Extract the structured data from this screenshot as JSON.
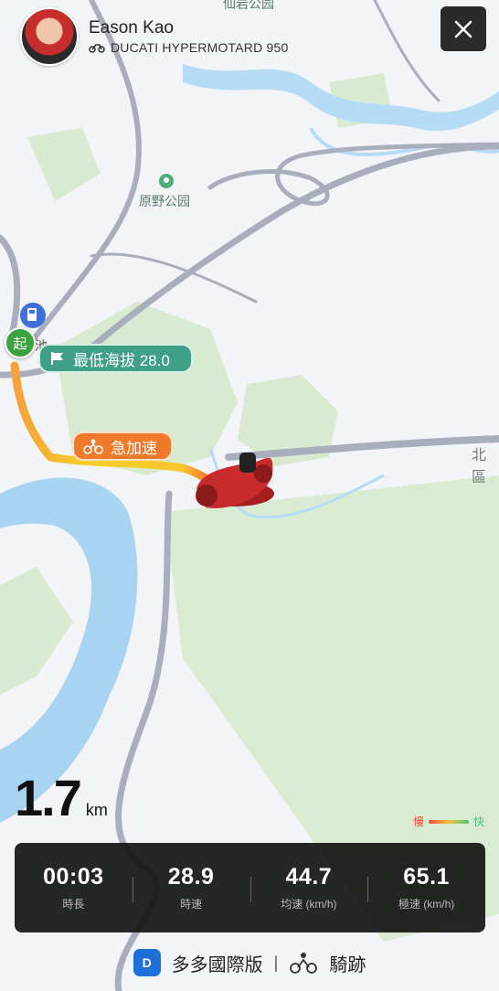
{
  "header": {
    "user_name": "Eason Kao",
    "bike_model": "DUCATI HYPERMOTARD 950",
    "close_icon": "close-icon"
  },
  "map": {
    "poi_park": "原野公园",
    "poi_top": "仙岩公园",
    "road_label": "北區",
    "start_label": "起",
    "pool_char": "池",
    "lowest_altitude": "最低海拔 28.0",
    "hard_accel": "急加速"
  },
  "distance": {
    "value": "1.7",
    "unit": "km"
  },
  "legend": {
    "slow": "慢",
    "fast": "快"
  },
  "stats": [
    {
      "value": "00:03",
      "label": "時長"
    },
    {
      "value": "28.9",
      "label": "時速"
    },
    {
      "value": "44.7",
      "label": "均速 (km/h)"
    },
    {
      "value": "65.1",
      "label": "極速 (km/h)"
    }
  ],
  "footer": {
    "app_name": "多多國際版",
    "separator": "|",
    "section": "騎跡"
  },
  "colors": {
    "water": "#a8d4f2",
    "green_area": "#d3e8c9",
    "road": "#a9aebd",
    "route_start": "#f4c82a",
    "route_end": "#ef4433",
    "pill_green": "#3f9f87",
    "pill_orange": "#f07a2a"
  }
}
